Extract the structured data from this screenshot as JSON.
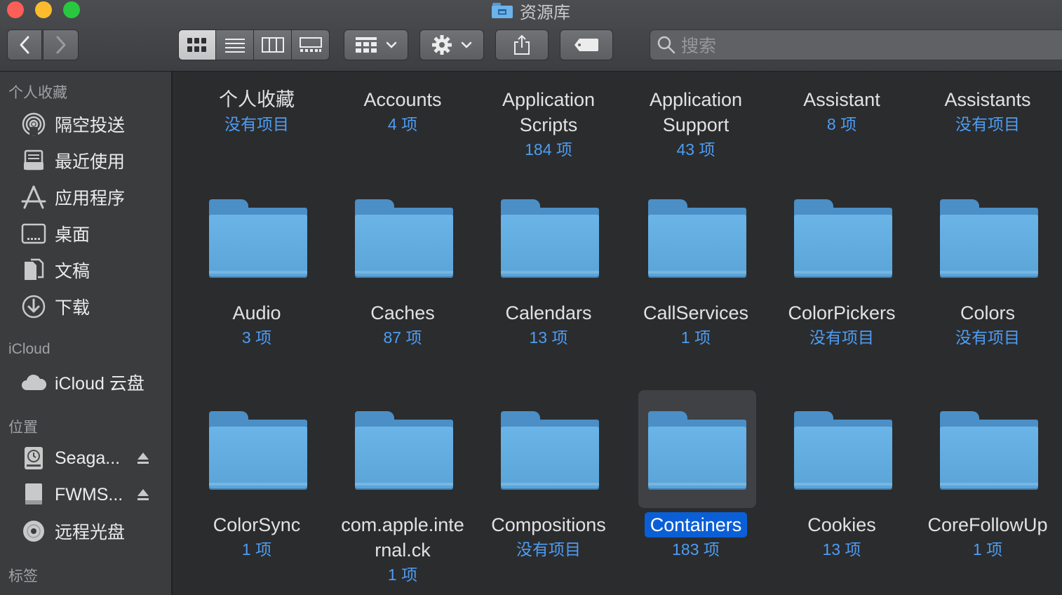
{
  "window": {
    "title": "资源库"
  },
  "toolbar": {
    "back_icon": "chevron-left-icon",
    "forward_icon": "chevron-right-icon",
    "views": [
      "icon-view",
      "list-view",
      "column-view",
      "gallery-view"
    ],
    "search_placeholder": "搜索"
  },
  "sidebar": {
    "favorites_header": "个人收藏",
    "favorites": [
      {
        "label": "隔空投送",
        "icon": "airdrop-icon"
      },
      {
        "label": "最近使用",
        "icon": "recents-icon"
      },
      {
        "label": "应用程序",
        "icon": "applications-icon"
      },
      {
        "label": "桌面",
        "icon": "desktop-icon"
      },
      {
        "label": "文稿",
        "icon": "documents-icon"
      },
      {
        "label": "下载",
        "icon": "downloads-icon"
      }
    ],
    "icloud_header": "iCloud",
    "icloud": [
      {
        "label": "iCloud 云盘",
        "icon": "cloud-icon"
      }
    ],
    "locations_header": "位置",
    "locations": [
      {
        "label": "Seaga...",
        "icon": "time-machine-disk-icon",
        "eject": true
      },
      {
        "label": "FWMS...",
        "icon": "external-disk-icon",
        "eject": true
      },
      {
        "label": "远程光盘",
        "icon": "remote-disc-icon",
        "eject": false
      }
    ],
    "tags_header": "标签"
  },
  "grid": {
    "row1": [
      {
        "name": "个人收藏",
        "count": "没有项目"
      },
      {
        "name": "Accounts",
        "count": "4 项"
      },
      {
        "name": "Application Scripts",
        "count": "184 项"
      },
      {
        "name": "Application Support",
        "count": "43 项"
      },
      {
        "name": "Assistant",
        "count": "8 项"
      },
      {
        "name": "Assistants",
        "count": "没有项目"
      }
    ],
    "row2": [
      {
        "name": "Audio",
        "count": "3 项"
      },
      {
        "name": "Caches",
        "count": "87 项"
      },
      {
        "name": "Calendars",
        "count": "13 项"
      },
      {
        "name": "CallServices",
        "count": "1 项"
      },
      {
        "name": "ColorPickers",
        "count": "没有项目"
      },
      {
        "name": "Colors",
        "count": "没有项目"
      }
    ],
    "row3": [
      {
        "name": "ColorSync",
        "count": "1 项"
      },
      {
        "name": "com.apple.internal.ck",
        "count": "1 项"
      },
      {
        "name": "Compositions",
        "count": "没有项目"
      },
      {
        "name": "Containers",
        "count": "183 项",
        "selected": true
      },
      {
        "name": "Cookies",
        "count": "13 项"
      },
      {
        "name": "CoreFollowUp",
        "count": "1 项"
      }
    ]
  },
  "colors": {
    "selection": "#0b5fd6",
    "count_text": "#4d9df4",
    "folder": "#6bb4e8"
  }
}
